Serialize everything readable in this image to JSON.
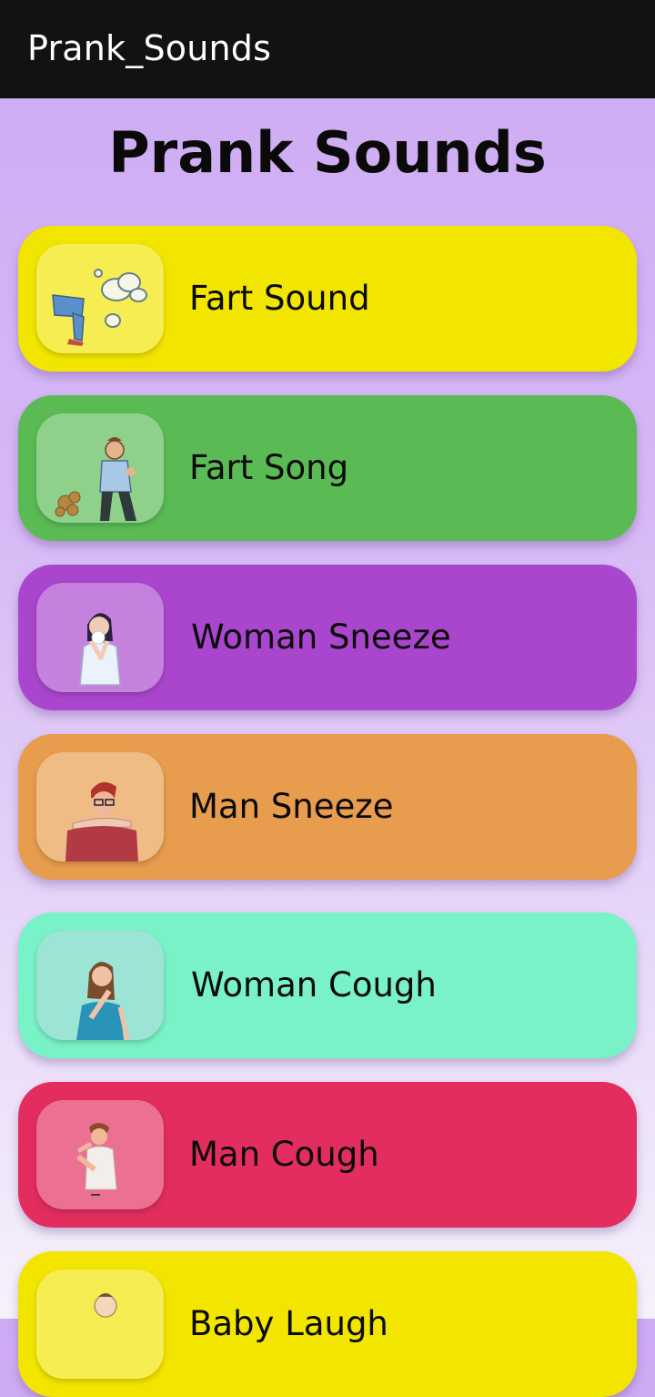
{
  "app": {
    "window_title": "Prank_Sounds"
  },
  "header": {
    "title": "Prank Sounds"
  },
  "sounds": [
    {
      "label": "Fart Sound",
      "icon": "fart-cloud-icon",
      "color": "#f2e500"
    },
    {
      "label": "Fart Song",
      "icon": "farting-man-icon",
      "color": "#5abb55"
    },
    {
      "label": "Woman Sneeze",
      "icon": "woman-sneeze-icon",
      "color": "#a946cd"
    },
    {
      "label": "Man Sneeze",
      "icon": "man-sneeze-icon",
      "color": "#e89c4d"
    },
    {
      "label": "Woman Cough",
      "icon": "woman-cough-icon",
      "color": "#78f2c6"
    },
    {
      "label": "Man Cough",
      "icon": "man-cough-icon",
      "color": "#e22d5e"
    },
    {
      "label": "Baby Laugh",
      "icon": "baby-icon",
      "color": "#f2e500"
    }
  ]
}
